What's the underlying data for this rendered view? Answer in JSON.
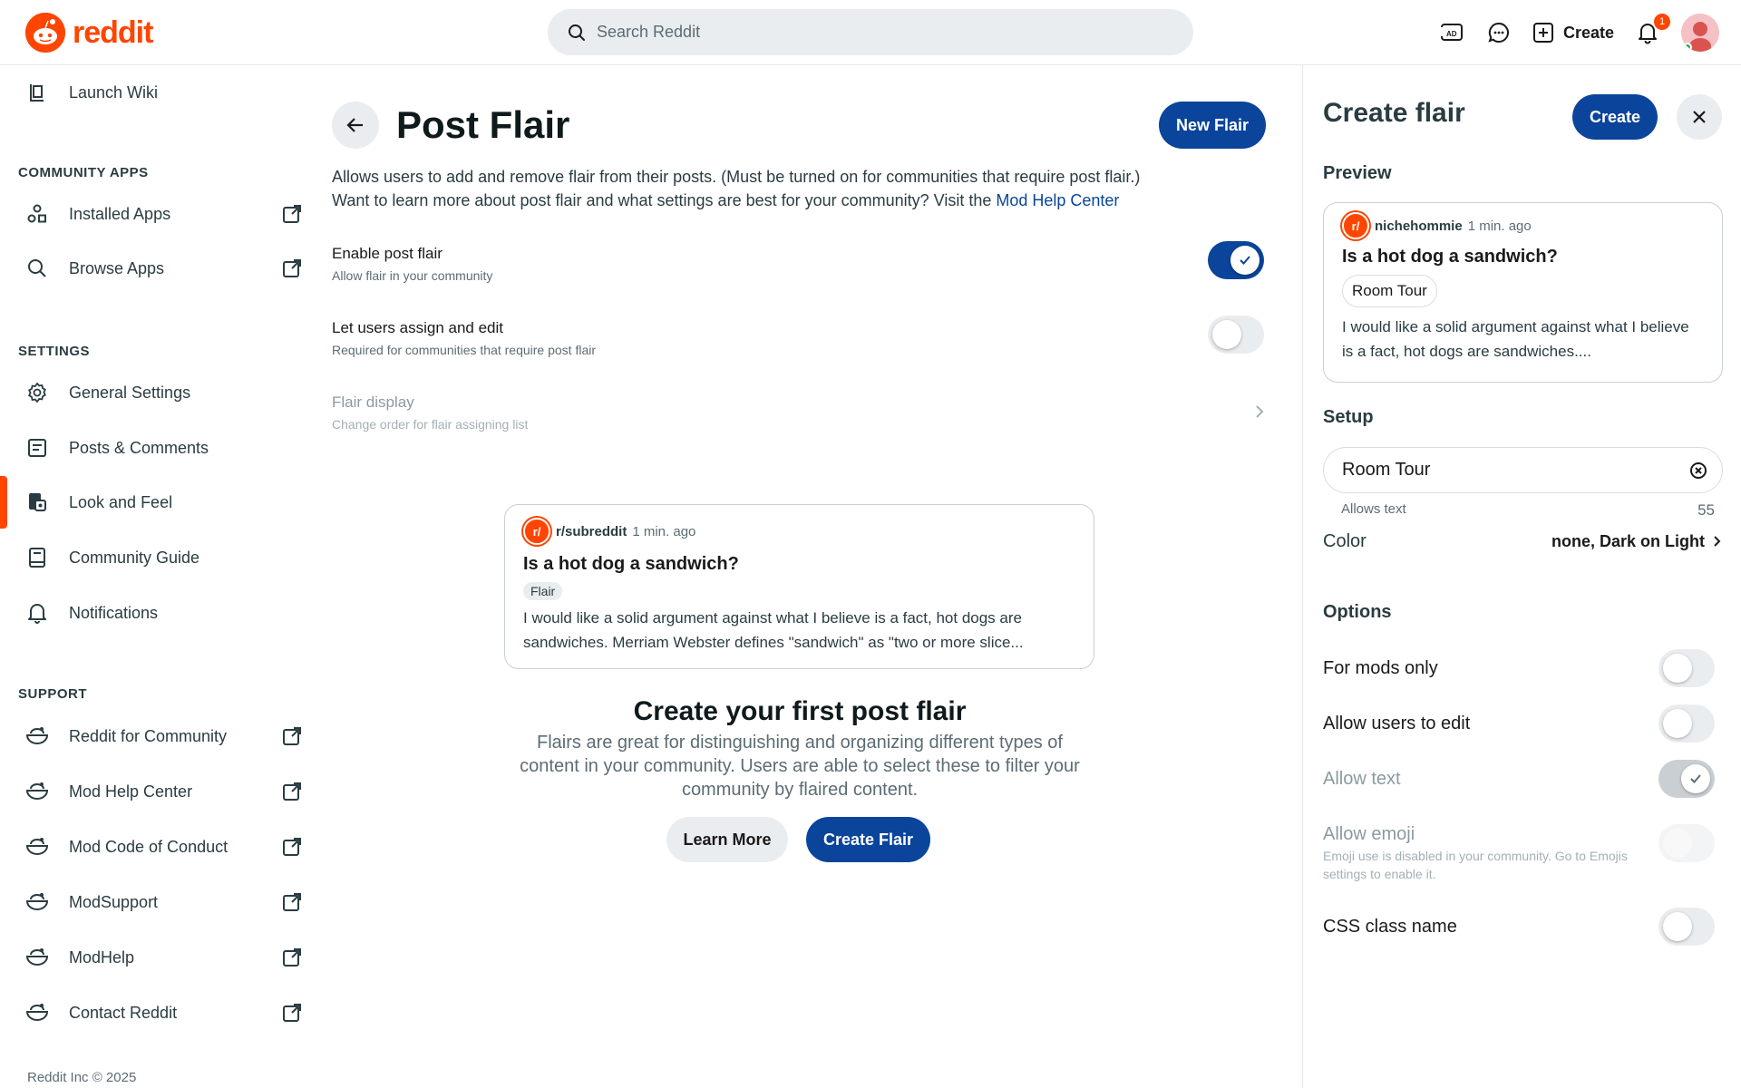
{
  "brand": {
    "wordmark": "reddit",
    "color": "#ff4500"
  },
  "header": {
    "search_placeholder": "Search Reddit",
    "create_label": "Create",
    "notification_count": "1"
  },
  "sidebar": {
    "top_item": {
      "label": "Launch Wiki",
      "icon": "wiki-icon"
    },
    "sections": {
      "community_apps": "COMMUNITY APPS",
      "settings": "SETTINGS",
      "support": "SUPPORT"
    },
    "community_apps": [
      {
        "label": "Installed Apps",
        "icon": "apps-icon",
        "external": true
      },
      {
        "label": "Browse Apps",
        "icon": "search-icon",
        "external": true
      }
    ],
    "settings": [
      {
        "label": "General Settings",
        "icon": "gear-icon"
      },
      {
        "label": "Posts & Comments",
        "icon": "posts-icon"
      },
      {
        "label": "Look and Feel",
        "icon": "paint-icon",
        "active": true
      },
      {
        "label": "Community Guide",
        "icon": "guide-icon"
      },
      {
        "label": "Notifications",
        "icon": "bell-icon"
      }
    ],
    "support": [
      {
        "label": "Reddit for Community",
        "icon": "snoo-icon",
        "external": true
      },
      {
        "label": "Mod Help Center",
        "icon": "snoo-icon",
        "external": true
      },
      {
        "label": "Mod Code of Conduct",
        "icon": "snoo-icon",
        "external": true
      },
      {
        "label": "ModSupport",
        "icon": "snoo-icon",
        "external": true
      },
      {
        "label": "ModHelp",
        "icon": "snoo-icon",
        "external": true
      },
      {
        "label": "Contact Reddit",
        "icon": "snoo-icon",
        "external": true
      }
    ],
    "footer": "Reddit Inc © 2025"
  },
  "main": {
    "title": "Post Flair",
    "new_flair_label": "New Flair",
    "description_line1": "Allows users to add and remove flair from their posts. (Must be turned on for communities that require post flair.)",
    "description_line2": "Want to learn more about post flair and what settings are best for your community? Visit the ",
    "description_link": "Mod Help Center",
    "settings": [
      {
        "title": "Enable post flair",
        "subtitle": "Allow flair in your community",
        "state": "on"
      },
      {
        "title": "Let users assign and edit",
        "subtitle": "Required for communities that require post flair",
        "state": "off"
      },
      {
        "title": "Flair display",
        "subtitle": "Change order for flair assigning list",
        "state": "disabled"
      }
    ],
    "example_post": {
      "subreddit": "r/subreddit",
      "time": "1 min. ago",
      "title": "Is a hot dog a sandwich?",
      "flair": "Flair",
      "body": "I would like a solid argument against what I believe is a fact, hot dogs are sandwiches. Merriam Webster defines \"sandwich\" as \"two or more slice..."
    },
    "empty_title": "Create your first post flair",
    "empty_desc": "Flairs are great for distinguishing and organizing different types of content in your community. Users are able to select these to filter your community by flaired content.",
    "learn_more_label": "Learn More",
    "create_flair_label": "Create Flair"
  },
  "panel": {
    "title": "Create flair",
    "create_label": "Create",
    "preview_heading": "Preview",
    "preview": {
      "user": "nichehommie",
      "time": "1 min. ago",
      "title": "Is a hot dog a sandwich?",
      "flair": "Room Tour",
      "body": "I would like a solid argument against what I believe is a fact, hot dogs are sandwiches...."
    },
    "setup_heading": "Setup",
    "flair_text_value": "Room Tour",
    "allows_text": "Allows text",
    "char_count": "55",
    "color_label": "Color",
    "color_value": "none, Dark on Light",
    "options_heading": "Options",
    "options": [
      {
        "label": "For mods only",
        "state": "off"
      },
      {
        "label": "Allow users to edit",
        "state": "off"
      },
      {
        "label": "Allow text",
        "state": "on-disabled"
      },
      {
        "label": "Allow emoji",
        "sublabel": "Emoji use is disabled in your community. Go to Emojis settings to enable it.",
        "state": "off-disabled"
      },
      {
        "label": "CSS class name",
        "state": "off"
      }
    ]
  },
  "colors": {
    "primary_button": "#0a449b",
    "accent": "#ff4500",
    "secondary_button": "#eaedef"
  }
}
